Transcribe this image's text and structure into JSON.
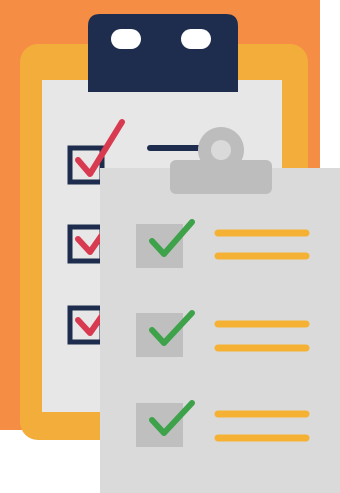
{
  "illustration": {
    "kind": "checklist-clipboards",
    "background_card_color": "#F58D45",
    "back_clipboard": {
      "board_color": "#F2AD3A",
      "paper_color": "#E7E7E8",
      "clip_color": "#1E2C4D",
      "checkbox_border_color": "#1E2C4D",
      "checkmark_color": "#D83A4F",
      "line_color": "#1E2C4D",
      "checked_items": 3
    },
    "front_clipboard": {
      "board_color": "#DADADA",
      "clip_color": "#BDBDBD",
      "checkbox_fill_color": "#BFBFBF",
      "checkmark_color": "#3DA24A",
      "line_color": "#F4B133",
      "checked_items": 3
    }
  }
}
